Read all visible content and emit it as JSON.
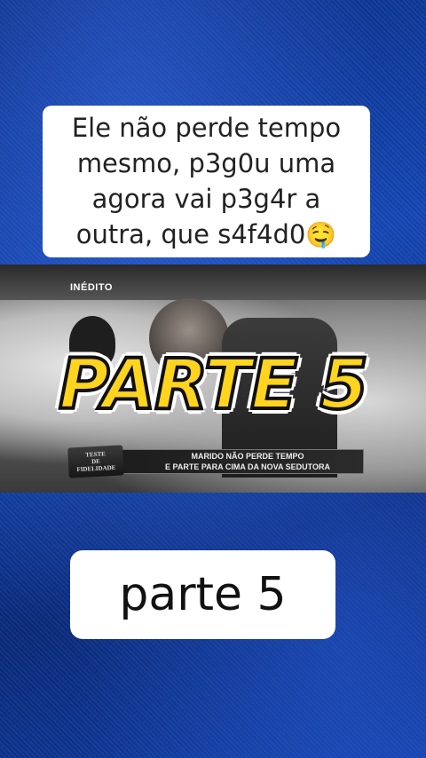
{
  "top_caption": {
    "line1": "Ele não perde tempo",
    "line2": "mesmo, p3g0u uma",
    "line3": "agora vai p3g4r a",
    "line4": "outra, que s4f4d0",
    "emoji": "🤤"
  },
  "video": {
    "badge": "INÉDITO",
    "show_logo_line1": "TESTE",
    "show_logo_line2": "DE",
    "show_logo_line3": "FIDELIDADE",
    "lower_third_line1": "MARIDO NÃO PERDE TEMPO",
    "lower_third_line2": "E PARTE PARA CIMA DA NOVA SEDUTORA"
  },
  "overlay_title": "PARTE 5",
  "bottom_caption": "parte 5",
  "colors": {
    "background_blue": "#1446b4",
    "title_yellow": "#ffd41f",
    "caption_bg": "#ffffff"
  }
}
